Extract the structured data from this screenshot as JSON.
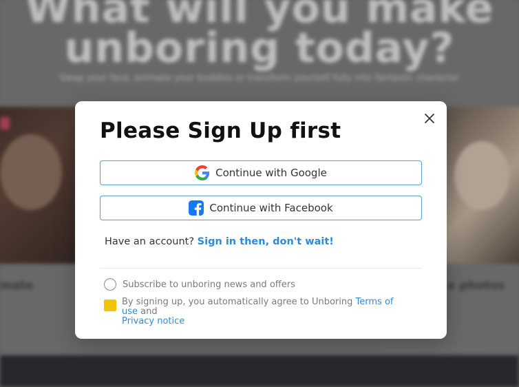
{
  "background": {
    "headline_line1": "What will you make",
    "headline_line2": "unboring today?",
    "subheadline": "Swap your face, animate your buddies or transform yourself fully into fantastic character",
    "caption_left": "mate",
    "caption_right": "e photos"
  },
  "modal": {
    "title": "Please Sign Up first",
    "google_label": "Continue with Google",
    "facebook_label": "Continue with Facebook",
    "have_account_text": "Have an account?",
    "sign_in_link": "Sign in then, don't wait!",
    "subscribe_label": "Subscribe to unboring news and offers",
    "terms_prefix": "By signing up, you automatically agree to Unboring",
    "terms_link": "Terms of use",
    "terms_and": "and",
    "privacy_link": "Privacy notice"
  },
  "icons": {
    "close": "close-icon",
    "google": "google-icon",
    "facebook": "facebook-icon"
  },
  "colors": {
    "link": "#2e8bd8",
    "button_border": "#5b9ed1",
    "checkbox_yellow": "#f5c20a",
    "facebook_blue": "#1877f2"
  }
}
